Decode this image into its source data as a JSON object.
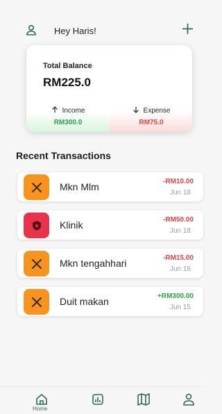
{
  "header": {
    "greeting": "Hey Haris!",
    "profile_icon": "user-icon",
    "add_icon": "plus-icon"
  },
  "balance": {
    "title": "Total Balance",
    "amount": "RM225.0",
    "income": {
      "label": "Income",
      "value": "RM300.0",
      "icon": "arrow-up-icon",
      "color": "#27a244"
    },
    "expense": {
      "label": "Expense",
      "value": "RM75.0",
      "icon": "arrow-down-icon",
      "color": "#e04444"
    }
  },
  "section_title": "Recent Transactions",
  "transactions": [
    {
      "name": "Mkn Mlm",
      "amount": "-RM10.00",
      "date": "Jun 18",
      "icon": "utensils-icon",
      "icon_bg": "#f7931e",
      "amount_color": "#e04444"
    },
    {
      "name": "Klinik",
      "amount": "-RM50.00",
      "date": "Jun 18",
      "icon": "shield-icon",
      "icon_bg": "#e8334a",
      "amount_color": "#e04444"
    },
    {
      "name": "Mkn tengahhari",
      "amount": "-RM15.00",
      "date": "Jun 16",
      "icon": "utensils-icon",
      "icon_bg": "#f7931e",
      "amount_color": "#e04444"
    },
    {
      "name": "Duit makan",
      "amount": "+RM300.00",
      "date": "Jun 15",
      "icon": "utensils-icon",
      "icon_bg": "#f7931e",
      "amount_color": "#27a244"
    }
  ],
  "nav": {
    "home_label": "Home",
    "items": [
      "home-icon",
      "chart-icon",
      "map-icon",
      "user-icon"
    ]
  }
}
